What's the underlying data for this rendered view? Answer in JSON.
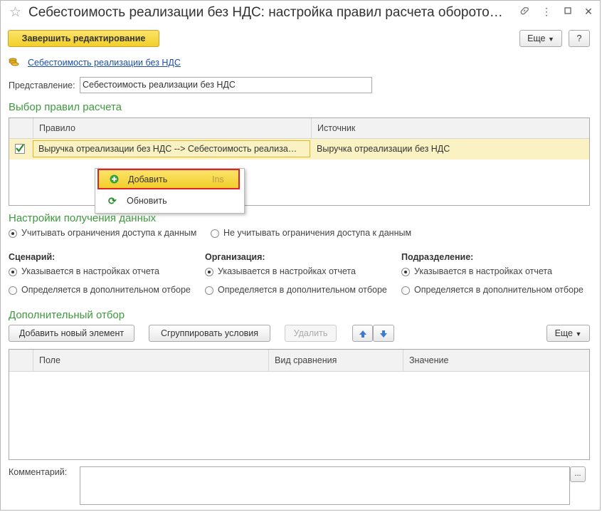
{
  "window": {
    "title": "Себестоимость реализации без НДС: настройка правил расчета оборото…",
    "link_icon": "link-icon",
    "menu_icon": "more-vertical-icon",
    "minimize_icon": "minimize-icon",
    "close_icon": "close-icon"
  },
  "toolbar": {
    "finish_label": "Завершить редактирование",
    "more_label": "Еще",
    "help_label": "?"
  },
  "breadcrumb": {
    "label": "Себестоимость реализации без НДС"
  },
  "representation": {
    "label": "Представление:",
    "value": "Себестоимость реализации без НДС"
  },
  "rules": {
    "section_title": "Выбор правил расчета",
    "columns": [
      "Правило",
      "Источник"
    ],
    "rows": [
      {
        "checked": true,
        "rule": "Выручка отреализации без НДС --> Себестоимость реализа…",
        "source": "Выручка отреализации без НДС"
      }
    ]
  },
  "context_menu": {
    "items": [
      {
        "label": "Добавить",
        "shortcut": "Ins",
        "icon": "add-icon"
      },
      {
        "label": "Обновить",
        "shortcut": "",
        "icon": "refresh-icon"
      }
    ]
  },
  "data_settings": {
    "section_title": "Настройки получения данных",
    "opt1": "Учитывать ограничения доступа к данным",
    "opt2": "Не  учитывать ограничения доступа к данным",
    "selected": 0
  },
  "groups": [
    {
      "title": "Сценарий:",
      "opt1": "Указывается в настройках отчета",
      "opt2": "Определяется в дополнительном отборе"
    },
    {
      "title": "Организация:",
      "opt1": "Указывается в настройках отчета",
      "opt2": "Определяется в дополнительном отборе"
    },
    {
      "title": "Подразделение:",
      "opt1": "Указывается в настройках отчета",
      "opt2": "Определяется в дополнительном отборе"
    }
  ],
  "filter": {
    "section_title": "Дополнительный отбор",
    "add_label": "Добавить новый элемент",
    "group_label": "Сгруппировать условия",
    "delete_label": "Удалить",
    "more_label": "Еще",
    "columns": [
      "Поле",
      "Вид сравнения",
      "Значение"
    ]
  },
  "comment": {
    "label": "Комментарий:",
    "value": "",
    "button_label": "..."
  },
  "colors": {
    "accent_green": "#3d9a3d",
    "button_yellow": "#f2cf2a",
    "highlight_red": "#d9242b",
    "row_yellow": "#fbf2c4",
    "arrow_blue": "#3b7bd4"
  }
}
